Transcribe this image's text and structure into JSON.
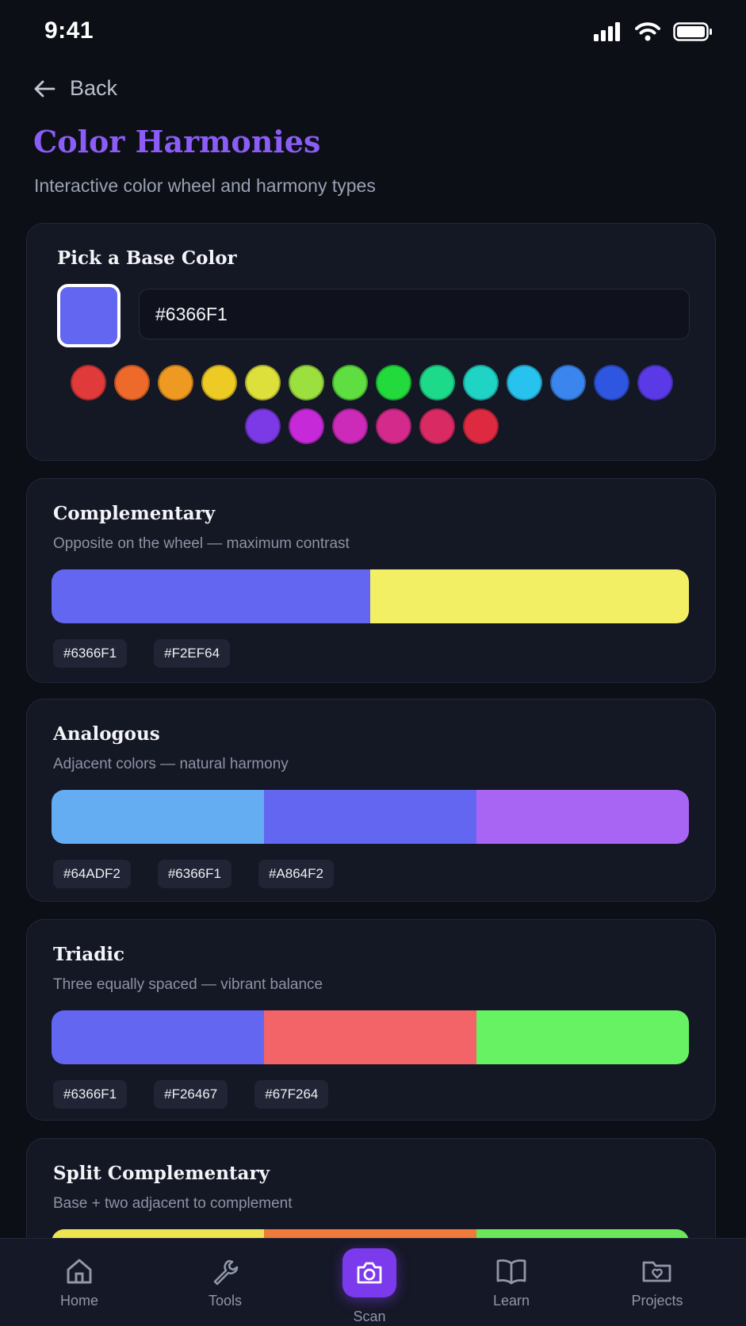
{
  "status_bar": {
    "time": "9:41"
  },
  "header": {
    "back_label": "Back",
    "title": "Color Harmonies",
    "subtitle": "Interactive color wheel and harmony types"
  },
  "picker": {
    "title": "Pick a Base Color",
    "base_color": "#6366F1",
    "hex_value": "#6366F1",
    "palette": [
      "#E03A3A",
      "#ED6A2A",
      "#EE9A22",
      "#EDCB24",
      "#DDE03A",
      "#9BE03F",
      "#5EDE40",
      "#22DA3C",
      "#1DD98A",
      "#1FD4C4",
      "#27C3EE",
      "#3A86EE",
      "#2F56E0",
      "#5A3AE6",
      "#7B3AE6",
      "#C62AD8",
      "#CC2AB8",
      "#D42A8C",
      "#DA2A64",
      "#DE2A40"
    ]
  },
  "harmonies": [
    {
      "title": "Complementary",
      "description": "Opposite on the wheel — maximum contrast",
      "colors": [
        "#6366F1",
        "#F2EF64"
      ],
      "labels": [
        "#6366F1",
        "#F2EF64"
      ]
    },
    {
      "title": "Analogous",
      "description": "Adjacent colors — natural harmony",
      "colors": [
        "#64ADF2",
        "#6366F1",
        "#A864F2"
      ],
      "labels": [
        "#64ADF2",
        "#6366F1",
        "#A864F2"
      ]
    },
    {
      "title": "Triadic",
      "description": "Three equally spaced — vibrant balance",
      "colors": [
        "#6366F1",
        "#F26467",
        "#67F264"
      ],
      "labels": [
        "#6366F1",
        "#F26467",
        "#67F264"
      ]
    },
    {
      "title": "Split Complementary",
      "description": "Base + two adjacent to complement",
      "colors": [
        "#EEE452",
        "#F07A3A",
        "#6AE85A"
      ],
      "labels": []
    }
  ],
  "nav": {
    "items": [
      {
        "label": "Home",
        "icon": "home-icon"
      },
      {
        "label": "Tools",
        "icon": "wrench-icon"
      },
      {
        "label": "Scan",
        "icon": "camera-icon",
        "active": true
      },
      {
        "label": "Learn",
        "icon": "book-icon"
      },
      {
        "label": "Projects",
        "icon": "folder-heart-icon"
      }
    ],
    "accent": "#7C3AED"
  }
}
